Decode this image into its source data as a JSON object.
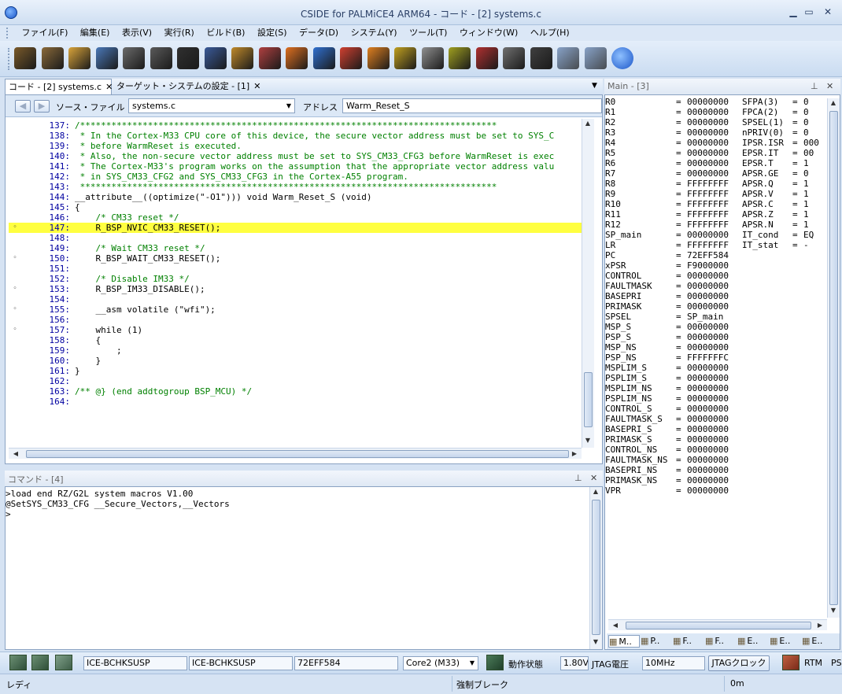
{
  "window": {
    "title": "CSIDE for PALMiCE4 ARM64 - コード - [2] systems.c",
    "minimize": "▁",
    "maximize": "▭",
    "close": "✕"
  },
  "menu": [
    "ファイル(F)",
    "編集(E)",
    "表示(V)",
    "実行(R)",
    "ビルド(B)",
    "設定(S)",
    "データ(D)",
    "システム(Y)",
    "ツール(T)",
    "ウィンドウ(W)",
    "ヘルプ(H)"
  ],
  "toolbar": {
    "icons": [
      "open-project-icon",
      "open-folder-icon",
      "folder-icon",
      "document-list-icon",
      "memory-icon",
      "register-icon",
      "terminal-icon",
      "watch-icon",
      "download-icon",
      "upload-icon",
      "reset-icon",
      "step-icon",
      "step-over-icon",
      "run-icon",
      "stop-icon",
      "break-icon",
      "trace-icon",
      "flash-icon",
      "camera-icon",
      "help-icon",
      "cloud-icon",
      "settings-icon",
      "refresh-icon"
    ],
    "colors": [
      "#7a5a2a",
      "#8a6a3a",
      "#d9a43a",
      "#4a78b8",
      "#6b6b6b",
      "#5a5a5a",
      "#303030",
      "#3a5a9a",
      "#c08a2a",
      "#b04040",
      "#e07020",
      "#3070d0",
      "#d04030",
      "#e08020",
      "#c0a020",
      "#909090",
      "#a0a020",
      "#b03030",
      "#707070",
      "#404040",
      "#6a8ab8",
      "#6a8ab8",
      "#2a6ad0"
    ]
  },
  "code_panel": {
    "tabs": [
      "コード - [2] systems.c",
      "ターゲット・システムの設定 - [1]"
    ],
    "source_label": "ソース・ファイル",
    "source_file": "systems.c",
    "address_label": "アドレス",
    "address_value": "Warm_Reset_S",
    "lines": [
      {
        "n": "137:",
        "t": "/********************************************************************************",
        "c": "cmt"
      },
      {
        "n": "138:",
        "t": " * In the Cortex-M33 CPU core of this device, the secure vector address must be set to SYS_C",
        "c": "cmt"
      },
      {
        "n": "139:",
        "t": " * before WarmReset is executed.",
        "c": "cmt"
      },
      {
        "n": "140:",
        "t": " * Also, the non-secure vector address must be set to SYS_CM33_CFG3 before WarmReset is exec",
        "c": "cmt"
      },
      {
        "n": "141:",
        "t": " * The Cortex-M33's program works on the assumption that the appropriate vector address valu",
        "c": "cmt"
      },
      {
        "n": "142:",
        "t": " * in SYS_CM33_CFG2 and SYS_CM33_CFG3 in the Cortex-A55 program.",
        "c": "cmt"
      },
      {
        "n": "143:",
        "t": " ********************************************************************************",
        "c": "cmt"
      },
      {
        "n": "144:",
        "t": "__attribute__((optimize(\"-O1\"))) void Warm_Reset_S (void)",
        "c": ""
      },
      {
        "n": "145:",
        "t": "{",
        "c": ""
      },
      {
        "n": "146:",
        "t": "    /* CM33 reset */",
        "c": "cmt"
      },
      {
        "n": "147:",
        "t": "    R_BSP_NVIC_CM33_RESET();",
        "c": "hl",
        "bp": "◦"
      },
      {
        "n": "148:",
        "t": "",
        "c": ""
      },
      {
        "n": "149:",
        "t": "    /* Wait CM33 reset */",
        "c": "cmt"
      },
      {
        "n": "150:",
        "t": "    R_BSP_WAIT_CM33_RESET();",
        "c": "",
        "bp": "◦"
      },
      {
        "n": "151:",
        "t": "",
        "c": ""
      },
      {
        "n": "152:",
        "t": "    /* Disable IM33 */",
        "c": "cmt"
      },
      {
        "n": "153:",
        "t": "    R_BSP_IM33_DISABLE();",
        "c": "",
        "bp": "◦"
      },
      {
        "n": "154:",
        "t": "",
        "c": ""
      },
      {
        "n": "155:",
        "t": "    __asm volatile (\"wfi\");",
        "c": "",
        "bp": "◦"
      },
      {
        "n": "156:",
        "t": "",
        "c": ""
      },
      {
        "n": "157:",
        "t": "    while (1)",
        "c": "",
        "bp": "◦"
      },
      {
        "n": "158:",
        "t": "    {",
        "c": ""
      },
      {
        "n": "159:",
        "t": "        ;",
        "c": ""
      },
      {
        "n": "160:",
        "t": "    }",
        "c": ""
      },
      {
        "n": "161:",
        "t": "}",
        "c": ""
      },
      {
        "n": "162:",
        "t": "",
        "c": ""
      },
      {
        "n": "163:",
        "t": "/** @} (end addtogroup BSP_MCU) */",
        "c": "cmt"
      },
      {
        "n": "164:",
        "t": "",
        "c": ""
      }
    ]
  },
  "command_panel": {
    "title": "コマンド - [4]",
    "lines": [
      ">load end RZ/G2L system macros V1.00",
      "@SetSYS_CM33_CFG __Secure_Vectors,__Vectors",
      ">"
    ]
  },
  "register_panel": {
    "title": "Main - [3]",
    "left": [
      [
        "R0",
        "00000000"
      ],
      [
        "R1",
        "00000000"
      ],
      [
        "R2",
        "00000000"
      ],
      [
        "R3",
        "00000000"
      ],
      [
        "R4",
        "00000000"
      ],
      [
        "R5",
        "00000000"
      ],
      [
        "R6",
        "00000000"
      ],
      [
        "R7",
        "00000000"
      ],
      [
        "R8",
        "FFFFFFFF"
      ],
      [
        "R9",
        "FFFFFFFF"
      ],
      [
        "R10",
        "FFFFFFFF"
      ],
      [
        "R11",
        "FFFFFFFF"
      ],
      [
        "R12",
        "FFFFFFFF"
      ],
      [
        "SP_main",
        "00000000"
      ],
      [
        "LR",
        "FFFFFFFF"
      ],
      [
        "PC",
        "72EFF584"
      ],
      [
        "xPSR",
        "F9000000"
      ],
      [
        "CONTROL",
        "00000000"
      ],
      [
        "FAULTMASK",
        "00000000"
      ],
      [
        "BASEPRI",
        "00000000"
      ],
      [
        "PRIMASK",
        "00000000"
      ],
      [
        "SPSEL",
        "SP_main"
      ],
      [
        "MSP_S",
        "00000000"
      ],
      [
        "PSP_S",
        "00000000"
      ],
      [
        "MSP_NS",
        "00000000"
      ],
      [
        "PSP_NS",
        "FFFFFFFC"
      ],
      [
        "MSPLIM_S",
        "00000000"
      ],
      [
        "PSPLIM_S",
        "00000000"
      ],
      [
        "MSPLIM_NS",
        "00000000"
      ],
      [
        "PSPLIM_NS",
        "00000000"
      ],
      [
        "CONTROL_S",
        "00000000"
      ],
      [
        "FAULTMASK_S",
        "00000000"
      ],
      [
        "BASEPRI_S",
        "00000000"
      ],
      [
        "PRIMASK_S",
        "00000000"
      ],
      [
        "CONTROL_NS",
        "00000000"
      ],
      [
        "FAULTMASK_NS",
        "00000000"
      ],
      [
        "BASEPRI_NS",
        "00000000"
      ],
      [
        "PRIMASK_NS",
        "00000000"
      ],
      [
        "VPR",
        "00000000"
      ]
    ],
    "right": [
      [
        "SFPA(3)",
        "0"
      ],
      [
        "FPCA(2)",
        "0"
      ],
      [
        "SPSEL(1)",
        "0"
      ],
      [
        "nPRIV(0)",
        "0"
      ],
      [
        "IPSR.ISR",
        "000"
      ],
      [
        "EPSR.IT",
        "00"
      ],
      [
        "EPSR.T",
        "1"
      ],
      [
        "APSR.GE",
        "0"
      ],
      [
        "APSR.Q",
        "1"
      ],
      [
        "APSR.V",
        "1"
      ],
      [
        "APSR.C",
        "1"
      ],
      [
        "APSR.Z",
        "1"
      ],
      [
        "APSR.N",
        "1"
      ],
      [
        "IT_cond",
        "EQ"
      ],
      [
        "IT_stat",
        "-"
      ]
    ],
    "bottom_tabs": [
      "M..",
      "P..",
      "F..",
      "F..",
      "E..",
      "E..",
      "E.."
    ]
  },
  "status": {
    "adapter1": "ICE-BCHKSUSP",
    "adapter2": "ICE-BCHKSUSP",
    "pc": "72EFF584",
    "core": "Core2 (M33)",
    "state_label": "動作状態",
    "voltage": "1.80V",
    "voltage_label": "JTAG電圧",
    "clock": "10MHz",
    "clock_label": "JTAGクロック",
    "rtm": "RTM",
    "ps": "PS",
    "ready": "レディ",
    "break": "強制ブレーク",
    "time": "0m"
  }
}
